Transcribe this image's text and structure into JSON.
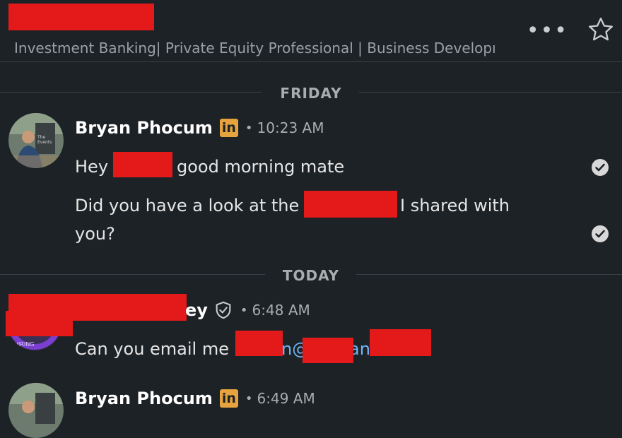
{
  "header": {
    "subtitle": "Investment Banking| Private Equity Professional | Business Developı",
    "more_label": "•••"
  },
  "conversation": {
    "day_dividers": [
      "FRIDAY",
      "TODAY"
    ],
    "messages": [
      {
        "sender": "Bryan Phocum",
        "badge": "in",
        "time": "10:23 AM",
        "lines": [
          {
            "before": "Hey",
            "after": "good morning mate"
          },
          {
            "before": "Did you have a look at the",
            "after": "I shared with",
            "cont": "you?"
          }
        ]
      },
      {
        "sender_suffix": "ey",
        "time": "6:48 AM",
        "text_before": "Can you email me",
        "at_text": "n@",
        "link_tail": "an",
        "avatar_text": "HIRING"
      },
      {
        "sender": "Bryan Phocum",
        "badge": "in",
        "time": "6:49 AM"
      }
    ]
  },
  "colors": {
    "background": "#1d2226",
    "badge": "#e7a33e",
    "link": "#70b5f9",
    "redaction": "#e41a1a"
  }
}
